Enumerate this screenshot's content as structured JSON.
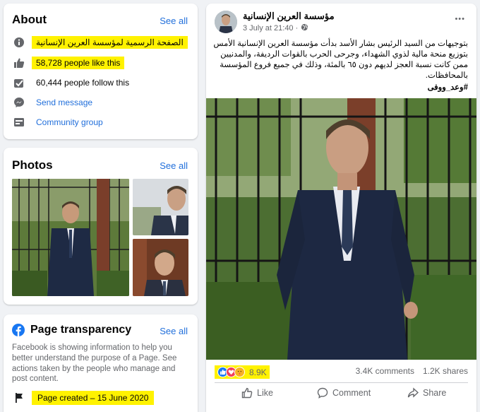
{
  "about": {
    "title": "About",
    "see_all": "See all",
    "description": "الصفحة الرسمية لمؤسسة العرين الإنسانية",
    "likes": "58,728 people like this",
    "follows": "60,444 people follow this",
    "send_message": "Send message",
    "community": "Community group"
  },
  "photos": {
    "title": "Photos",
    "see_all": "See all"
  },
  "transparency": {
    "title": "Page transparency",
    "see_all": "See all",
    "body": "Facebook is showing information to help you better understand the purpose of a Page. See actions taken by the people who manage and post content.",
    "created": "Page created – 15 June 2020"
  },
  "post": {
    "page_name": "مؤسسة العرين الإنسانية",
    "timestamp": "3 July at 21:40 ·",
    "text": "بتوجيهات من السيد الرئيس بشار الأسد بدأت مؤسسة العرين الإنسانية الأمس بتوزيع منحة مالية لذوي الشهداء، وجرحى الحرب بالقوات الرديفة، والمدنيين ممن كانت نسبة العجز لديهم دون ٦٥ بالمئة، وذلك في جميع فروع المؤسسة بالمحافظات.",
    "hashtag": "#وعد_ووفى",
    "reactions_count": "8.9K",
    "comments": "3.4K comments",
    "shares": "1.2K shares",
    "like_label": "Like",
    "comment_label": "Comment",
    "share_label": "Share",
    "more": "•••"
  },
  "colors": {
    "highlight": "#fff200",
    "link": "#216fdb",
    "background": "#f0f2f5"
  }
}
